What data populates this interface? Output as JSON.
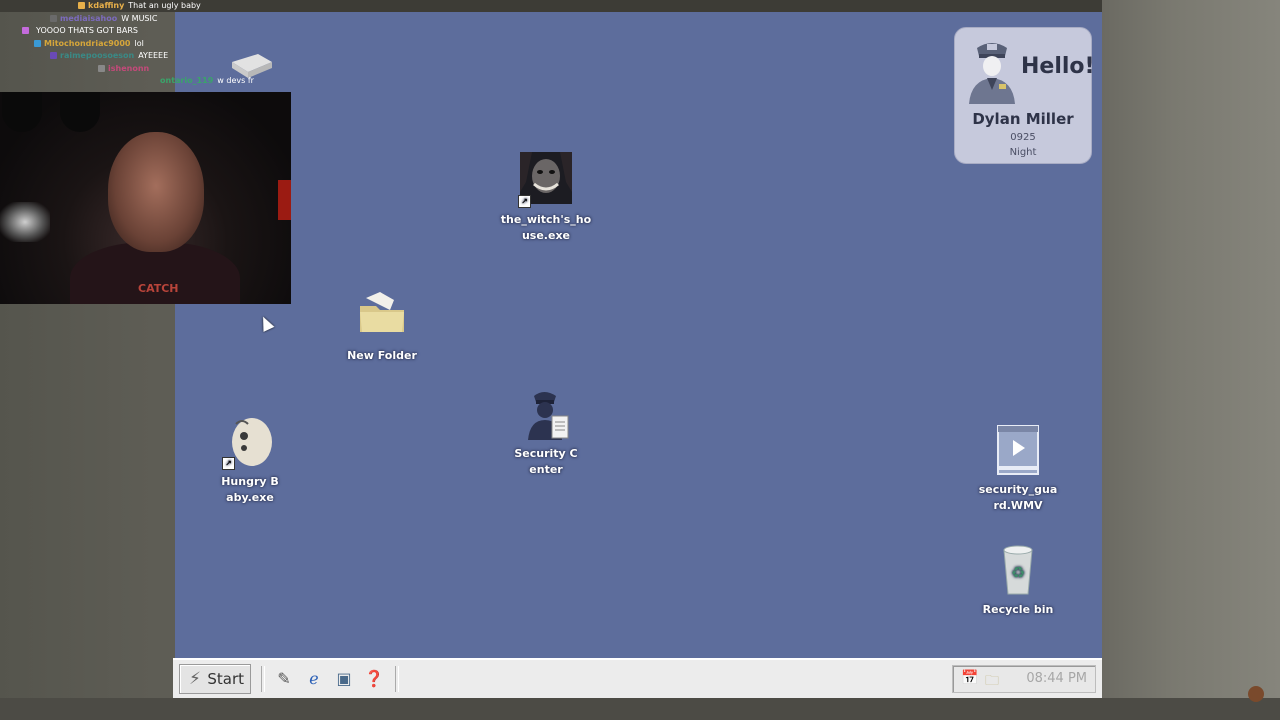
{
  "chat": [
    {
      "user": "kdaffiny",
      "user_color": "#e8b04a",
      "badge_color": "#e8b04a",
      "message": "That an ugly baby"
    },
    {
      "user": "mediaisahoo",
      "user_color": "#7c6bbd",
      "badge_color": "#6a6a6a",
      "message": "W MUSIC"
    },
    {
      "user": "",
      "user_color": "#8e4fc4",
      "badge_color": "#c46bdc",
      "message": "YOOOO THATS GOT BARS"
    },
    {
      "user": "Mitochondriac9000",
      "user_color": "#d6a63a",
      "badge_color": "#3a9ad6",
      "message": "lol"
    },
    {
      "user": "raimepoosoeson",
      "user_color": "#3a8a86",
      "badge_color": "#6a4ab6",
      "message": "AYEEEE"
    },
    {
      "user": "ishenonn",
      "user_color": "#c44a7a",
      "badge_color": "#888888",
      "message": ""
    },
    {
      "user": "ontario_119",
      "user_color": "#3aa46a",
      "badge_color": "",
      "message": "w devs fr"
    }
  ],
  "desktop_icons": {
    "witch": {
      "label": "the_witch's_house.exe",
      "icon": "witch-face-icon"
    },
    "folder": {
      "label": "New Folder",
      "icon": "folder-icon"
    },
    "security_center": {
      "label": "Security Center",
      "icon": "security-guard-icon"
    },
    "hungry_baby": {
      "label": "Hungry Baby.exe",
      "icon": "baby-head-icon"
    },
    "video": {
      "label": "security_guard.WMV",
      "icon": "video-file-icon"
    },
    "recycle": {
      "label": "Recycle bin",
      "icon": "recycle-bin-icon"
    }
  },
  "hello_card": {
    "greeting": "Hello!",
    "name": "Dylan Miller",
    "id": "0925",
    "shift": "Night"
  },
  "taskbar": {
    "start_label": "Start",
    "clock": "08:44 PM"
  },
  "webcam": {
    "shirt_text": "CATCH"
  },
  "colors": {
    "desktop_bg": "#5d6d9c",
    "taskbar_bg": "#ececec",
    "card_bg": "#c6c9dc"
  }
}
